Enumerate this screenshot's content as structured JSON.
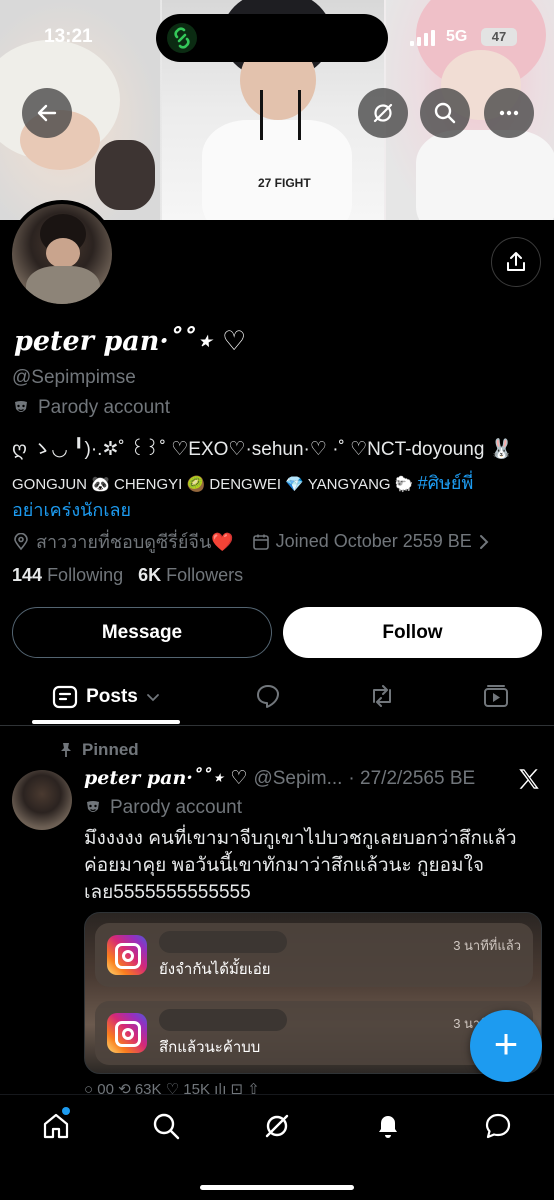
{
  "status_bar": {
    "time": "13:21",
    "network": "5G",
    "battery": "47"
  },
  "profile": {
    "display_name": "peter pan·˚˚⋆ ♡",
    "handle": "@Sepimpimse",
    "parody_label": "Parody account",
    "bio_line1": "ღ ゝ◡ ╹)·.✲˚ ꒰꒱˚ ♡EXO♡·sehun·♡ ·˚ ♡NCT-doyoung 🐰",
    "bio_line2_prefix": "GONGJUN 🐼 CHENGYI 🥝 DENGWEI 💎 YANGYANG 🐑 ",
    "bio_hashtag_part1": "#ศิษย์พี่",
    "bio_hashtag_part2": "อย่าเคร่งนักเลย",
    "location": "สาววายที่ชอบดูซีรี่ย์จีน❤️",
    "joined": "Joined October 2559 BE",
    "following_count": "144",
    "following_label": "Following",
    "followers_count": "6K",
    "followers_label": "Followers"
  },
  "buttons": {
    "message": "Message",
    "follow": "Follow"
  },
  "tabs": {
    "posts": "Posts"
  },
  "post": {
    "pinned_label": "Pinned",
    "name": "peter pan·˚˚⋆ ♡",
    "handle": "@Sepim...",
    "date": "· 27/2/2565 BE",
    "parody_label": "Parody account",
    "text": "มึงงงงง คนที่เขามาจีบกูเขาไปบวชกูเลยบอกว่าสึกแล้วค่อยมาคุย พอวันนี้เขาทักมาว่าสึกแล้วนะ กูยอมใจเลย5555555555555",
    "notifications": [
      {
        "time": "3 นาทีที่แล้ว",
        "message": "ยังจำกันได้มั้ยเอ่ย"
      },
      {
        "time": "3 นาทีที่แล้ว",
        "message": "สึกแล้วนะค้าบบ"
      }
    ],
    "actions_partial": "○ 00    ⟲ 63K    ♡ 15K    ı|ı    ⊡    ⇧"
  },
  "colors": {
    "accent": "#1d9bf0",
    "muted": "#71767b",
    "background": "#000000"
  }
}
